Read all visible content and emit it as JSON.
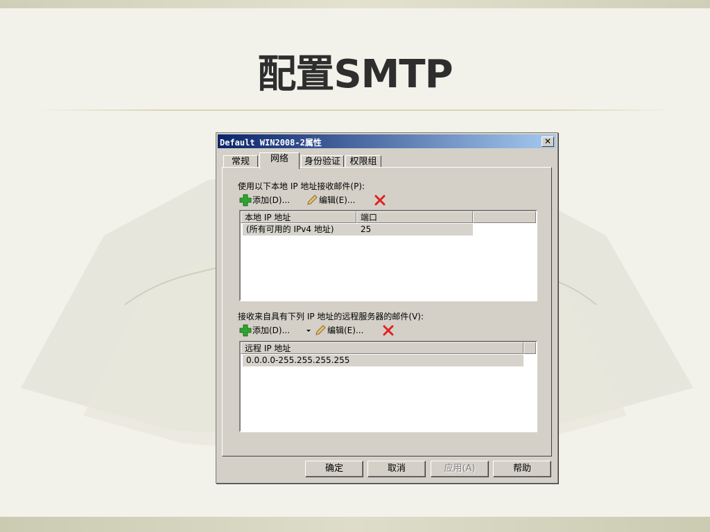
{
  "slide": {
    "title": "配置SMTP"
  },
  "dialog": {
    "title": "Default WIN2008-2属性",
    "close_glyph": "✕",
    "tabs": [
      {
        "label": "常规",
        "active": false
      },
      {
        "label": "网络",
        "active": true
      },
      {
        "label": "身份验证",
        "active": false
      },
      {
        "label": "权限组",
        "active": false
      }
    ],
    "local_section": {
      "label": "使用以下本地 IP 地址接收邮件(P):",
      "add_label": "添加(D)...",
      "edit_label": "编辑(E)...",
      "columns": [
        "本地 IP 地址",
        "端口"
      ],
      "rows": [
        {
          "address": "(所有可用的 IPv4 地址)",
          "port": "25"
        }
      ]
    },
    "remote_section": {
      "label": "接收来自具有下列 IP 地址的远程服务器的邮件(V):",
      "add_label": "添加(D)...",
      "edit_label": "编辑(E)...",
      "columns": [
        "远程 IP 地址"
      ],
      "rows": [
        {
          "address": "0.0.0.0-255.255.255.255"
        }
      ]
    },
    "buttons": {
      "ok": "确定",
      "cancel": "取消",
      "apply": "应用(A)",
      "help": "帮助"
    }
  },
  "colors": {
    "titlebar_start": "#0a246a",
    "titlebar_end": "#a6caf0",
    "dialog_face": "#d4d0c8",
    "add_icon": "#2fa52f",
    "delete_icon": "#e02020"
  }
}
